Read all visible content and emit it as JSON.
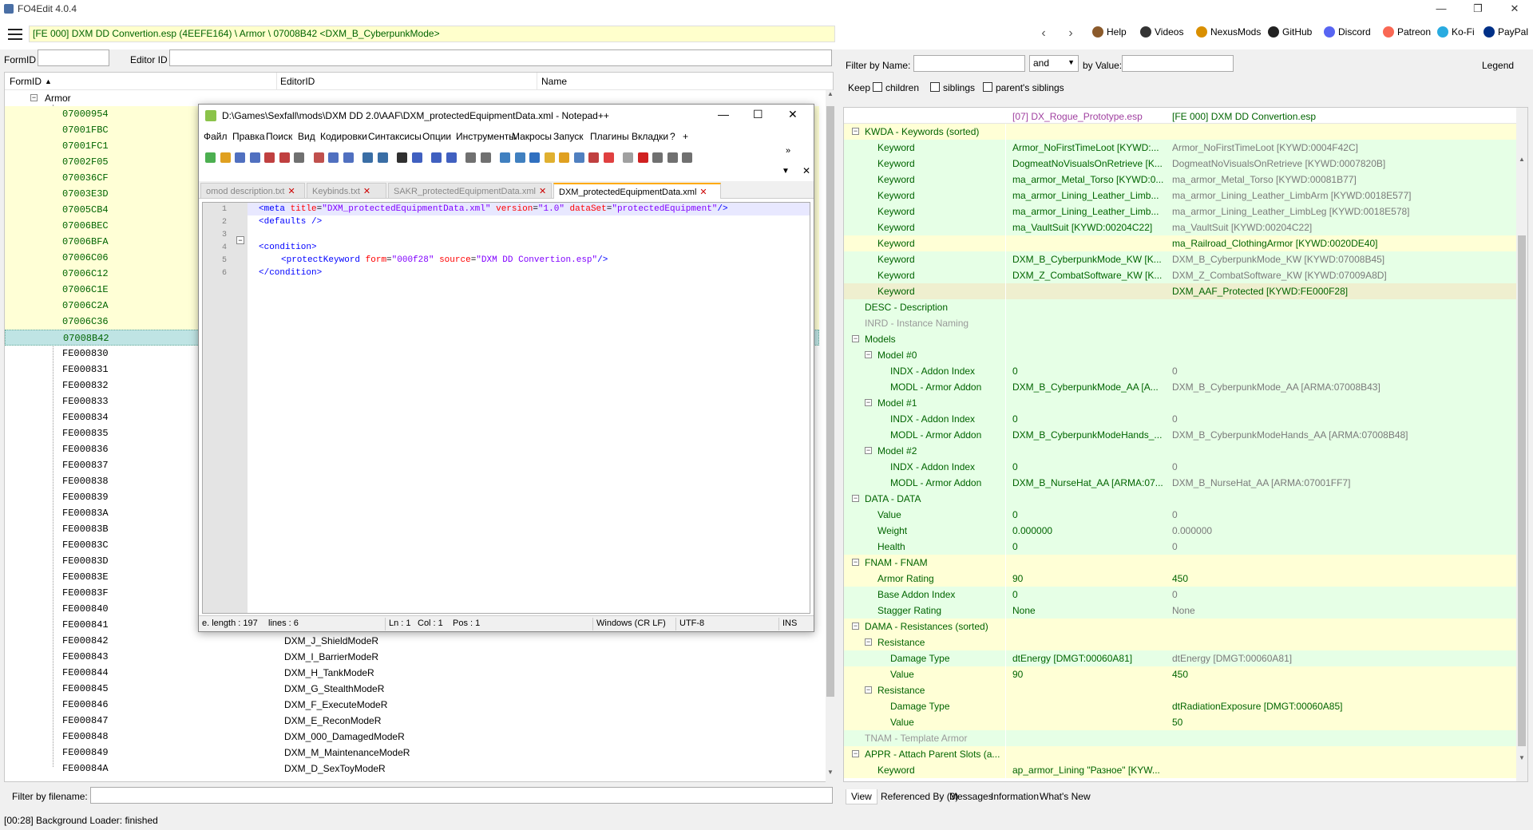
{
  "app": {
    "title": "FO4Edit 4.0.4"
  },
  "window_controls": {
    "minimize": "—",
    "maximize": "❐",
    "close": "✕"
  },
  "path": "[FE 000] DXM DD Convertion.esp (4EEFE164) \\ Armor \\ 07008B42 <DXM_B_CyberpunkMode>",
  "toplinks": [
    {
      "label": "Help",
      "icon": "book-icon",
      "color": "#8b5a2b"
    },
    {
      "label": "Videos",
      "icon": "video-icon",
      "color": "#333"
    },
    {
      "label": "NexusMods",
      "icon": "nexus-icon",
      "color": "#d98f00"
    },
    {
      "label": "GitHub",
      "icon": "github-icon",
      "color": "#222"
    },
    {
      "label": "Discord",
      "icon": "discord-icon",
      "color": "#5865f2"
    },
    {
      "label": "Patreon",
      "icon": "patreon-icon",
      "color": "#f96854"
    },
    {
      "label": "Ko-Fi",
      "icon": "kofi-icon",
      "color": "#29abe0"
    },
    {
      "label": "PayPal",
      "icon": "paypal-icon",
      "color": "#003087"
    }
  ],
  "left": {
    "formid_label": "FormID",
    "editorid_label": "Editor ID",
    "columns": [
      "FormID",
      "EditorID",
      "Name"
    ],
    "group": "Armor",
    "rows": [
      {
        "fid": "07000954",
        "name": "",
        "hl": "y"
      },
      {
        "fid": "07001FBC",
        "name": "",
        "hl": "y"
      },
      {
        "fid": "07001FC1",
        "name": "",
        "hl": "y"
      },
      {
        "fid": "07002F05",
        "name": "",
        "hl": "y"
      },
      {
        "fid": "070036CF",
        "name": "",
        "hl": "y"
      },
      {
        "fid": "07003E3D",
        "name": "",
        "hl": "y"
      },
      {
        "fid": "07005CB4",
        "name": "",
        "hl": "y"
      },
      {
        "fid": "07006BEC",
        "name": "",
        "hl": "y"
      },
      {
        "fid": "07006BFA",
        "name": "",
        "hl": "y"
      },
      {
        "fid": "07006C06",
        "name": "",
        "hl": "y"
      },
      {
        "fid": "07006C12",
        "name": "",
        "hl": "y"
      },
      {
        "fid": "07006C1E",
        "name": "",
        "hl": "y"
      },
      {
        "fid": "07006C2A",
        "name": "",
        "hl": "y"
      },
      {
        "fid": "07006C36",
        "name": "",
        "hl": "y"
      },
      {
        "fid": "07008B42",
        "name": "",
        "hl": "sel"
      },
      {
        "fid": "FE000830",
        "name": "",
        "hl": ""
      },
      {
        "fid": "FE000831",
        "name": "",
        "hl": ""
      },
      {
        "fid": "FE000832",
        "name": "",
        "hl": ""
      },
      {
        "fid": "FE000833",
        "name": "",
        "hl": ""
      },
      {
        "fid": "FE000834",
        "name": "",
        "hl": ""
      },
      {
        "fid": "FE000835",
        "name": "",
        "hl": ""
      },
      {
        "fid": "FE000836",
        "name": "",
        "hl": ""
      },
      {
        "fid": "FE000837",
        "name": "",
        "hl": ""
      },
      {
        "fid": "FE000838",
        "name": "",
        "hl": ""
      },
      {
        "fid": "FE000839",
        "name": "",
        "hl": ""
      },
      {
        "fid": "FE00083A",
        "name": "",
        "hl": ""
      },
      {
        "fid": "FE00083B",
        "name": "",
        "hl": ""
      },
      {
        "fid": "FE00083C",
        "name": "",
        "hl": ""
      },
      {
        "fid": "FE00083D",
        "name": "",
        "hl": ""
      },
      {
        "fid": "FE00083E",
        "name": "",
        "hl": ""
      },
      {
        "fid": "FE00083F",
        "name": "",
        "hl": ""
      },
      {
        "fid": "FE000840",
        "name": "",
        "hl": ""
      },
      {
        "fid": "FE000841",
        "name": "",
        "hl": ""
      },
      {
        "fid": "FE000842",
        "name": "DXM_J_ShieldModeR",
        "hl": ""
      },
      {
        "fid": "FE000843",
        "name": "DXM_I_BarrierModeR",
        "hl": ""
      },
      {
        "fid": "FE000844",
        "name": "DXM_H_TankModeR",
        "hl": ""
      },
      {
        "fid": "FE000845",
        "name": "DXM_G_StealthModeR",
        "hl": ""
      },
      {
        "fid": "FE000846",
        "name": "DXM_F_ExecuteModeR",
        "hl": ""
      },
      {
        "fid": "FE000847",
        "name": "DXM_E_ReconModeR",
        "hl": ""
      },
      {
        "fid": "FE000848",
        "name": "DXM_000_DamagedModeR",
        "hl": ""
      },
      {
        "fid": "FE000849",
        "name": "DXM_M_MaintenanceModeR",
        "hl": ""
      },
      {
        "fid": "FE00084A",
        "name": "DXM_D_SexToyModeR",
        "hl": ""
      }
    ],
    "filter_label": "Filter by filename:"
  },
  "right": {
    "filter_name_label": "Filter by Name:",
    "and_value": "and",
    "by_value_label": "by Value:",
    "legend": "Legend",
    "keep_label": "Keep",
    "keep_opts": [
      "children",
      "siblings",
      "parent's siblings"
    ],
    "col1": "[07] DX_Rogue_Prototype.esp",
    "col2": "[FE 000] DXM DD Convertion.esp",
    "rows": [
      {
        "lvl": 0,
        "exp": "−",
        "label": "KWDA - Keywords (sorted)",
        "v1": "",
        "v2": "",
        "c": "yel",
        "g": ""
      },
      {
        "lvl": 1,
        "exp": "",
        "label": "Keyword",
        "v1": "Armor_NoFirstTimeLoot [KYWD:...",
        "v2": "Armor_NoFirstTimeLoot [KYWD:0004F42C]",
        "c": "",
        "g": "gy"
      },
      {
        "lvl": 1,
        "exp": "",
        "label": "Keyword",
        "v1": "DogmeatNoVisualsOnRetrieve [K...",
        "v2": "DogmeatNoVisualsOnRetrieve [KYWD:0007820B]",
        "c": "",
        "g": "gy"
      },
      {
        "lvl": 1,
        "exp": "",
        "label": "Keyword",
        "v1": "ma_armor_Metal_Torso [KYWD:0...",
        "v2": "ma_armor_Metal_Torso [KYWD:00081B77]",
        "c": "",
        "g": "gy"
      },
      {
        "lvl": 1,
        "exp": "",
        "label": "Keyword",
        "v1": "ma_armor_Lining_Leather_Limb...",
        "v2": "ma_armor_Lining_Leather_LimbArm [KYWD:0018E577]",
        "c": "",
        "g": "gy"
      },
      {
        "lvl": 1,
        "exp": "",
        "label": "Keyword",
        "v1": "ma_armor_Lining_Leather_Limb...",
        "v2": "ma_armor_Lining_Leather_LimbLeg [KYWD:0018E578]",
        "c": "",
        "g": "gy"
      },
      {
        "lvl": 1,
        "exp": "",
        "label": "Keyword",
        "v1": "ma_VaultSuit [KYWD:00204C22]",
        "v2": "ma_VaultSuit [KYWD:00204C22]",
        "c": "",
        "g": "gy"
      },
      {
        "lvl": 1,
        "exp": "",
        "label": "Keyword",
        "v1": "",
        "v2": "ma_Railroad_ClothingArmor [KYWD:0020DE40]",
        "c": "yel",
        "g": "dg"
      },
      {
        "lvl": 1,
        "exp": "",
        "label": "Keyword",
        "v1": "DXM_B_CyberpunkMode_KW [K...",
        "v2": "DXM_B_CyberpunkMode_KW [KYWD:07008B45]",
        "c": "",
        "g": "gy"
      },
      {
        "lvl": 1,
        "exp": "",
        "label": "Keyword",
        "v1": "DXM_Z_CombatSoftware_KW [K...",
        "v2": "DXM_Z_CombatSoftware_KW [KYWD:07009A8D]",
        "c": "",
        "g": "gy"
      },
      {
        "lvl": 1,
        "exp": "",
        "label": "Keyword",
        "v1": "",
        "v2": "DXM_AAF_Protected [KYWD:FE000F28]",
        "c": "tan",
        "g": "dg"
      },
      {
        "lvl": 0,
        "exp": "",
        "label": "DESC - Description",
        "v1": "",
        "v2": "",
        "c": "",
        "g": ""
      },
      {
        "lvl": 0,
        "exp": "",
        "label": "INRD - Instance Naming",
        "v1": "",
        "v2": "",
        "c": "dis",
        "g": ""
      },
      {
        "lvl": 0,
        "exp": "−",
        "label": "Models",
        "v1": "",
        "v2": "",
        "c": "",
        "g": ""
      },
      {
        "lvl": 1,
        "exp": "−",
        "label": "Model #0",
        "v1": "",
        "v2": "",
        "c": "",
        "g": ""
      },
      {
        "lvl": 2,
        "exp": "",
        "label": "INDX - Addon Index",
        "v1": "0",
        "v2": "0",
        "c": "",
        "g": "gy"
      },
      {
        "lvl": 2,
        "exp": "",
        "label": "MODL - Armor Addon",
        "v1": "DXM_B_CyberpunkMode_AA [A...",
        "v2": "DXM_B_CyberpunkMode_AA [ARMA:07008B43]",
        "c": "",
        "g": "gy"
      },
      {
        "lvl": 1,
        "exp": "−",
        "label": "Model #1",
        "v1": "",
        "v2": "",
        "c": "",
        "g": ""
      },
      {
        "lvl": 2,
        "exp": "",
        "label": "INDX - Addon Index",
        "v1": "0",
        "v2": "0",
        "c": "",
        "g": "gy"
      },
      {
        "lvl": 2,
        "exp": "",
        "label": "MODL - Armor Addon",
        "v1": "DXM_B_CyberpunkModeHands_...",
        "v2": "DXM_B_CyberpunkModeHands_AA [ARMA:07008B48]",
        "c": "",
        "g": "gy"
      },
      {
        "lvl": 1,
        "exp": "−",
        "label": "Model #2",
        "v1": "",
        "v2": "",
        "c": "",
        "g": ""
      },
      {
        "lvl": 2,
        "exp": "",
        "label": "INDX - Addon Index",
        "v1": "0",
        "v2": "0",
        "c": "",
        "g": "gy"
      },
      {
        "lvl": 2,
        "exp": "",
        "label": "MODL - Armor Addon",
        "v1": "DXM_B_NurseHat_AA [ARMA:07...",
        "v2": "DXM_B_NurseHat_AA [ARMA:07001FF7]",
        "c": "",
        "g": "gy"
      },
      {
        "lvl": 0,
        "exp": "−",
        "label": "DATA - DATA",
        "v1": "",
        "v2": "",
        "c": "",
        "g": ""
      },
      {
        "lvl": 1,
        "exp": "",
        "label": "Value",
        "v1": "0",
        "v2": "0",
        "c": "",
        "g": "gy"
      },
      {
        "lvl": 1,
        "exp": "",
        "label": "Weight",
        "v1": "0.000000",
        "v2": "0.000000",
        "c": "",
        "g": "gy"
      },
      {
        "lvl": 1,
        "exp": "",
        "label": "Health",
        "v1": "0",
        "v2": "0",
        "c": "",
        "g": "gy"
      },
      {
        "lvl": 0,
        "exp": "−",
        "label": "FNAM - FNAM",
        "v1": "",
        "v2": "",
        "c": "yel",
        "g": ""
      },
      {
        "lvl": 1,
        "exp": "",
        "label": "Armor Rating",
        "v1": "90",
        "v2": "450",
        "c": "yel",
        "g": "dg"
      },
      {
        "lvl": 1,
        "exp": "",
        "label": "Base Addon Index",
        "v1": "0",
        "v2": "0",
        "c": "",
        "g": "gy"
      },
      {
        "lvl": 1,
        "exp": "",
        "label": "Stagger Rating",
        "v1": "None",
        "v2": "None",
        "c": "",
        "g": "gy"
      },
      {
        "lvl": 0,
        "exp": "−",
        "label": "DAMA - Resistances (sorted)",
        "v1": "",
        "v2": "",
        "c": "yel",
        "g": ""
      },
      {
        "lvl": 1,
        "exp": "−",
        "label": "Resistance",
        "v1": "",
        "v2": "",
        "c": "yel",
        "g": ""
      },
      {
        "lvl": 2,
        "exp": "",
        "label": "Damage Type",
        "v1": "dtEnergy [DMGT:00060A81]",
        "v2": "dtEnergy [DMGT:00060A81]",
        "c": "",
        "g": "gy"
      },
      {
        "lvl": 2,
        "exp": "",
        "label": "Value",
        "v1": "90",
        "v2": "450",
        "c": "yel",
        "g": "dg"
      },
      {
        "lvl": 1,
        "exp": "−",
        "label": "Resistance",
        "v1": "",
        "v2": "",
        "c": "yel",
        "g": ""
      },
      {
        "lvl": 2,
        "exp": "",
        "label": "Damage Type",
        "v1": "",
        "v2": "dtRadiationExposure [DMGT:00060A85]",
        "c": "yel",
        "g": "dg"
      },
      {
        "lvl": 2,
        "exp": "",
        "label": "Value",
        "v1": "",
        "v2": "50",
        "c": "yel",
        "g": "dg"
      },
      {
        "lvl": 0,
        "exp": "",
        "label": "TNAM - Template Armor",
        "v1": "",
        "v2": "",
        "c": "dis",
        "g": ""
      },
      {
        "lvl": 0,
        "exp": "−",
        "label": "APPR - Attach Parent Slots (a...",
        "v1": "",
        "v2": "",
        "c": "yel",
        "g": ""
      },
      {
        "lvl": 1,
        "exp": "",
        "label": "Keyword",
        "v1": "ap_armor_Lining \"Разное\" [KYW...",
        "v2": "",
        "c": "yel",
        "g": ""
      }
    ],
    "tabs": [
      "View",
      "Referenced By (3)",
      "Messages",
      "Information",
      "What's New"
    ]
  },
  "status": "[00:28] Background Loader: finished",
  "npp": {
    "title": "D:\\Games\\Sexfall\\mods\\DXM DD 2.0\\AAF\\DXM_protectedEquipmentData.xml - Notepad++",
    "menu": [
      "Файл",
      "Правка",
      "Поиск",
      "Вид",
      "Кодировки",
      "Синтаксисы",
      "Опции",
      "Инструменты",
      "Макросы",
      "Запуск",
      "Плагины",
      "Вкладки",
      "?",
      "+"
    ],
    "tabs": [
      "omod description.txt",
      "Keybinds.txt",
      "SAKR_protectedEquipmentData.xml",
      "DXM_protectedEquipmentData.xml"
    ],
    "lines": [
      "1",
      "2",
      "3",
      "4",
      "5",
      "6"
    ],
    "status": {
      "length": "e. length : 197",
      "lines": "lines : 6",
      "ln": "Ln : 1",
      "col": "Col : 1",
      "pos": "Pos : 1",
      "eol": "Windows (CR LF)",
      "enc": "UTF-8",
      "mode": "INS"
    },
    "code": {
      "l1_tag": "<meta",
      "l1_a1": "title",
      "l1_v1": "\"DXM_protectedEquipmentData.xml\"",
      "l1_a2": "version",
      "l1_v2": "\"1.0\"",
      "l1_a3": "dataSet",
      "l1_v3": "\"protectedEquipment\"",
      "l1_end": "/>",
      "l2": "<defaults />",
      "l4": "<condition>",
      "l5_tag": "<protectKeyword",
      "l5_a1": "form",
      "l5_v1": "\"000f28\"",
      "l5_a2": "source",
      "l5_v2": "\"DXM DD Convertion.esp\"",
      "l5_end": "/>",
      "l6": "</condition>"
    }
  }
}
